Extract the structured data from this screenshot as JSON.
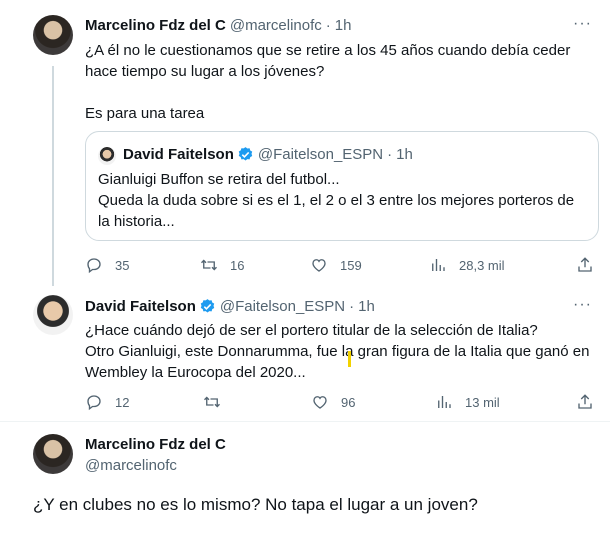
{
  "reply1": {
    "name": "Marcelino Fdz del C",
    "handle": "@marcelinofc",
    "separator": "·",
    "time": "1h",
    "more": "···",
    "text": "¿A él no le cuestionamos que se retire a los 45 años cuando debía ceder\nhace tiempo su lugar a los jóvenes?\n\nEs para una tarea",
    "quote": {
      "name": "David Faitelson",
      "handle": "@Faitelson_ESPN",
      "separator": "·",
      "time": "1h",
      "text": "Gianluigi Buffon se retira del futbol...\nQueda la duda sobre si es el 1, el 2 o el 3 entre los mejores porteros de\nla historia..."
    },
    "actions": {
      "replies": "35",
      "retweets": "16",
      "likes": "159",
      "views": "28,3 mil"
    }
  },
  "reply2": {
    "name": "David Faitelson",
    "handle": "@Faitelson_ESPN",
    "separator": "·",
    "time": "1h",
    "more": "···",
    "text": "¿Hace cuándo dejó de ser el portero titular de la selección de Italia?\nOtro Gianluigi, este Donnarumma, fue la gran figura de la Italia que ganó en\nWembley la Eurocopa del 2020...",
    "actions": {
      "replies": "12",
      "retweets": "",
      "likes": "96",
      "views": "13 mil"
    }
  },
  "main": {
    "name": "Marcelino Fdz del C",
    "handle": "@marcelinofc",
    "text": "¿Y en clubes no es lo mismo? No tapa el lugar a un joven?"
  },
  "colors": {
    "accent": "#1d9bf0",
    "muted": "#536471",
    "text": "#0f1419",
    "border": "#cfd9de"
  },
  "icons": [
    "reply-icon",
    "retweet-icon",
    "like-icon",
    "views-icon",
    "share-icon",
    "verified-badge-icon",
    "more-icon"
  ]
}
